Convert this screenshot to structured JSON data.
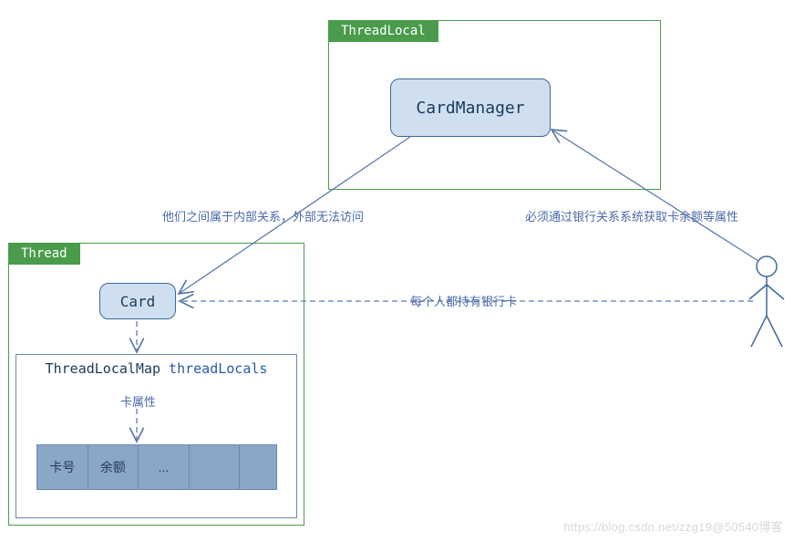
{
  "boxes": {
    "threadlocal": {
      "title": "ThreadLocal"
    },
    "thread": {
      "title": "Thread"
    }
  },
  "classes": {
    "cardmanager": {
      "label": "CardManager"
    },
    "card": {
      "label": "Card"
    }
  },
  "map": {
    "type": "ThreadLocalMap",
    "name": "threadLocals",
    "cells": [
      "卡号",
      "余额",
      "..."
    ]
  },
  "annotations": {
    "internal": "他们之间属于内部关系，外部无法访问",
    "bank": "必须通过银行关系系统获取卡余额等属性",
    "holds": "每个人都持有银行卡",
    "attr": "卡属性"
  },
  "watermark": "https://blog.csdn.net/zzg19@50540博客"
}
